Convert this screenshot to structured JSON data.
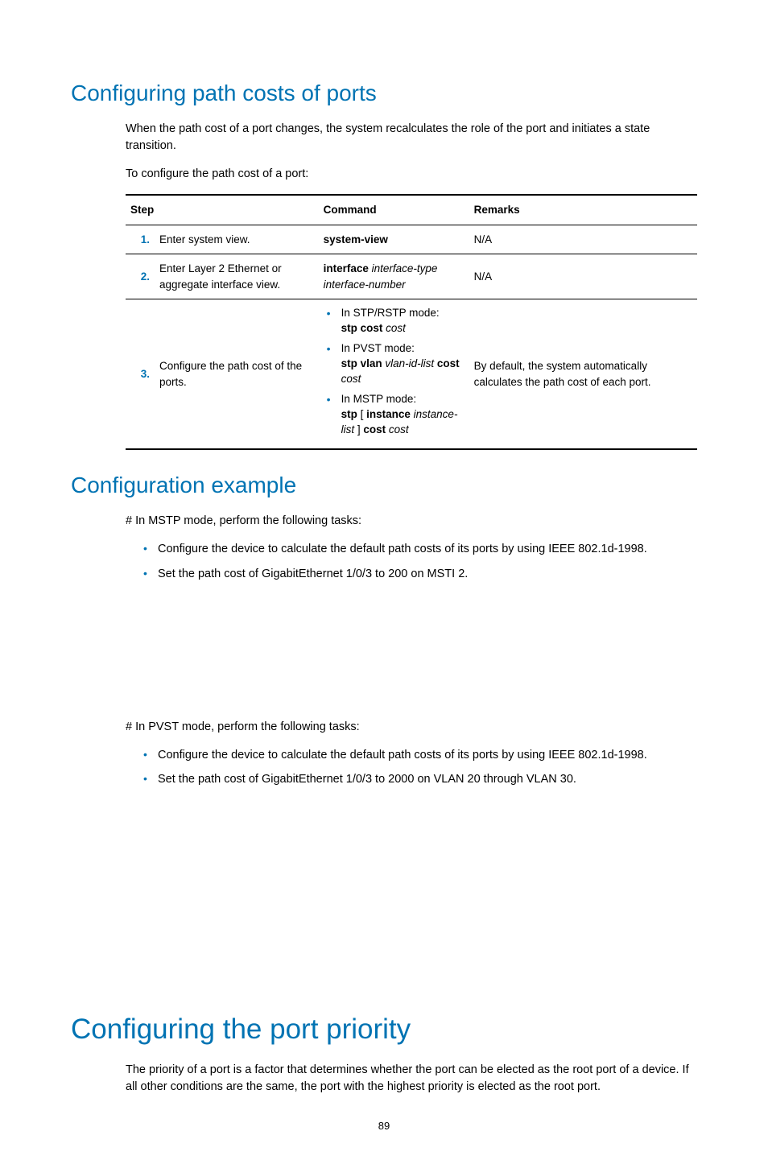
{
  "section1": {
    "heading": "Configuring path costs of ports",
    "para1": "When the path cost of a port changes, the system recalculates the role of the port and initiates a state transition.",
    "para2": "To configure the path cost of a port:"
  },
  "table": {
    "hdr_step": "Step",
    "hdr_command": "Command",
    "hdr_remarks": "Remarks",
    "rows": [
      {
        "num": "1.",
        "step": "Enter system view.",
        "cmd_bold": "system-view",
        "remarks": "N/A"
      },
      {
        "num": "2.",
        "step": "Enter Layer 2 Ethernet or aggregate interface view.",
        "cmd_bold": "interface",
        "cmd_ital": " interface-type interface-number",
        "remarks": "N/A"
      },
      {
        "num": "3.",
        "step": "Configure the path cost of the ports.",
        "modes": {
          "m1_label": "In STP/RSTP mode:",
          "m1_b1": "stp cost",
          "m1_i1": " cost",
          "m2_label": "In PVST mode:",
          "m2_b1": "stp vlan",
          "m2_i1": " vlan-id-list ",
          "m2_b2": "cost",
          "m2_i2": " cost",
          "m3_label": "In MSTP mode:",
          "m3_b1": "stp",
          "m3_t1": " [ ",
          "m3_b2": "instance",
          "m3_i1": " instance-list",
          "m3_t2": " ] ",
          "m3_b3": "cost",
          "m3_i2": " cost"
        },
        "remarks": "By default, the system automatically calculates the path cost of each port."
      }
    ]
  },
  "section2": {
    "heading": "Configuration example",
    "para1": "# In MSTP mode, perform the following tasks:",
    "bullets1": [
      "Configure the device to calculate the default path costs of its ports by using IEEE 802.1d-1998.",
      "Set the path cost of GigabitEthernet 1/0/3 to 200 on MSTI 2."
    ],
    "para2": "# In PVST mode, perform the following tasks:",
    "bullets2": [
      "Configure the device to calculate the default path costs of its ports by using IEEE 802.1d-1998.",
      "Set the path cost of GigabitEthernet 1/0/3 to 2000 on VLAN 20 through VLAN 30."
    ]
  },
  "section3": {
    "heading": "Configuring the port priority",
    "para1": "The priority of a port is a factor that determines whether the port can be elected as the root port of a device. If all other conditions are the same, the port with the highest priority is elected as the root port."
  },
  "pagenum": "89"
}
